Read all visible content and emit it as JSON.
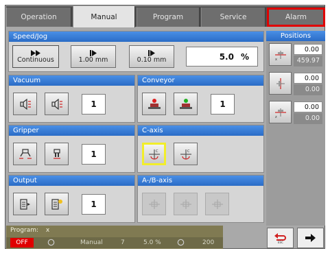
{
  "tabs": [
    {
      "label": "Operation"
    },
    {
      "label": "Manual"
    },
    {
      "label": "Program"
    },
    {
      "label": "Service"
    },
    {
      "label": "Alarm"
    }
  ],
  "speed": {
    "title": "Speed/Jog",
    "continuous_label": "Continuous",
    "step1_label": "1.00 mm",
    "step2_label": "0.10 mm",
    "speed_value": "5.0",
    "speed_unit": "%"
  },
  "vacuum": {
    "title": "Vacuum",
    "value": "1"
  },
  "conveyor": {
    "title": "Conveyor",
    "value": "1"
  },
  "gripper": {
    "title": "Gripper",
    "value": "1"
  },
  "caxis": {
    "title": "C-axis"
  },
  "output": {
    "title": "Output",
    "value": "1"
  },
  "abaxis": {
    "title": "A-/B-axis"
  },
  "positions": {
    "title": "Positions",
    "rows": [
      {
        "set": "0.00",
        "actual": "459.97"
      },
      {
        "set": "0.00",
        "actual": "0.00"
      },
      {
        "set": "0.00",
        "actual": "0.00"
      }
    ]
  },
  "status": {
    "program_label": "Program:",
    "program_value": "x",
    "off_label": "OFF",
    "mode": "Manual",
    "mode_number": "7",
    "speed": "5.0 %",
    "count": "200"
  },
  "colors": {
    "section_header": "#3a7fd8",
    "alarm_border": "#e00000",
    "off_badge": "#e00000",
    "selected_border": "#f2ee2a"
  }
}
